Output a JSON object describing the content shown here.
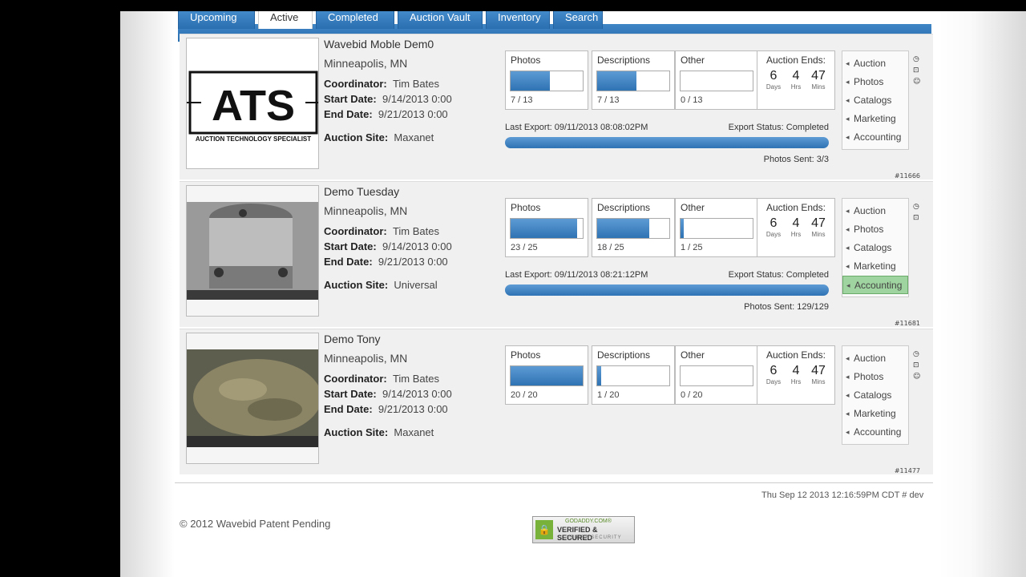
{
  "tabs": [
    "Upcoming",
    "Active",
    "Completed",
    "Auction Vault",
    "Inventory",
    "Search"
  ],
  "active_tab": "Active",
  "labels": {
    "coordinator": "Coordinator:",
    "start_date": "Start Date:",
    "end_date": "End Date:",
    "auction_site": "Auction Site:",
    "photos": "Photos",
    "descriptions": "Descriptions",
    "other": "Other",
    "auction_ends": "Auction Ends:",
    "days": "Days",
    "hrs": "Hrs",
    "mins": "Mins",
    "last_export": "Last Export:",
    "export_status": "Export Status:",
    "photos_sent": "Photos Sent:"
  },
  "menu_items": [
    "Auction",
    "Photos",
    "Catalogs",
    "Marketing",
    "Accounting"
  ],
  "auctions": [
    {
      "title": "Wavebid Moble Dem0",
      "location": "Minneapolis, MN",
      "coordinator": "Tim  Bates",
      "start_date": "9/14/2013 0:00",
      "end_date": "9/21/2013 0:00",
      "site": "Maxanet",
      "photos": {
        "count": "7 / 13",
        "fill": 0.54
      },
      "descriptions": {
        "count": "7 / 13",
        "fill": 0.54
      },
      "other": {
        "count": "0 / 13",
        "fill": 0
      },
      "ends": {
        "days": "6",
        "hrs": "4",
        "mins": "47"
      },
      "last_export": "09/11/2013 08:08:02PM",
      "export_status": "Completed",
      "photos_sent": "3/3",
      "id": "#11666",
      "highlighted_menu": "",
      "image": "ats-logo",
      "logo_text": "ATS",
      "logo_sub": "AUCTION TECHNOLOGY SPECIALIST"
    },
    {
      "title": "Demo Tuesday",
      "location": "Minneapolis, MN",
      "coordinator": "Tim  Bates",
      "start_date": "9/14/2013 0:00",
      "end_date": "9/21/2013 0:00",
      "site": "Universal",
      "photos": {
        "count": "23 / 25",
        "fill": 0.92
      },
      "descriptions": {
        "count": "18 / 25",
        "fill": 0.72
      },
      "other": {
        "count": "1 / 25",
        "fill": 0.04
      },
      "ends": {
        "days": "6",
        "hrs": "4",
        "mins": "47"
      },
      "last_export": "09/11/2013 08:21:12PM",
      "export_status": "Completed",
      "photos_sent": "129/129",
      "id": "#11681",
      "highlighted_menu": "Accounting",
      "image": "machine-part-photo"
    },
    {
      "title": "Demo Tony",
      "location": "Minneapolis, MN",
      "coordinator": "Tim  Bates",
      "start_date": "9/14/2013 0:00",
      "end_date": "9/21/2013 0:00",
      "site": "Maxanet",
      "photos": {
        "count": "20 / 20",
        "fill": 1.0
      },
      "descriptions": {
        "count": "1 / 20",
        "fill": 0.05
      },
      "other": {
        "count": "0 / 20",
        "fill": 0
      },
      "ends": {
        "days": "6",
        "hrs": "4",
        "mins": "47"
      },
      "id": "#11477",
      "highlighted_menu": "",
      "image": "duck-decoy-photo"
    }
  ],
  "footer": {
    "copyright": "© 2012 Wavebid Patent Pending",
    "timestamp": "Thu Sep 12 2013 12:16:59PM CDT  # dev",
    "badge_line1": "GODADDY.COM®",
    "badge_line2": "VERIFIED & SECURED",
    "badge_line3": "VERIFY SECURITY"
  },
  "colors": {
    "tab_blue": "#2a6fb0",
    "bar_blue": "#2f73b4",
    "highlight_green": "#9fd39f"
  }
}
